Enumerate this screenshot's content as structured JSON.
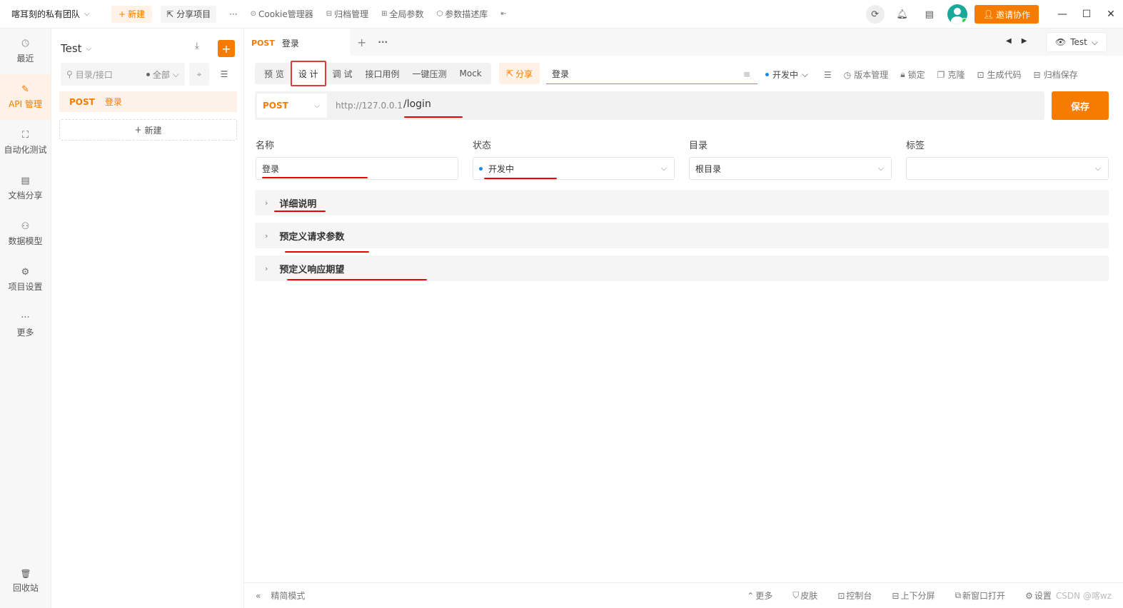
{
  "topbar": {
    "team": "喀耳刻的私有团队",
    "new_label": "新建",
    "share_project": "分享项目",
    "more": "···",
    "links": [
      {
        "icon": "cookie-icon",
        "label": "Cookie管理器"
      },
      {
        "icon": "archive-icon",
        "label": "归档管理"
      },
      {
        "icon": "global-params-icon",
        "label": "全局参数"
      },
      {
        "icon": "param-desc-icon",
        "label": "参数描述库"
      }
    ],
    "invite_label": "邀请协作"
  },
  "leftnav": {
    "items": [
      {
        "icon": "clock-icon",
        "label": "最近",
        "active": false
      },
      {
        "icon": "api-edit-icon",
        "label": "API 管理",
        "active": true
      },
      {
        "icon": "automation-icon",
        "label": "自动化测试",
        "active": false
      },
      {
        "icon": "doc-share-icon",
        "label": "文档分享",
        "active": false
      },
      {
        "icon": "data-model-icon",
        "label": "数据模型",
        "active": false
      },
      {
        "icon": "project-settings-icon",
        "label": "项目设置",
        "active": false
      },
      {
        "icon": "more-dots-icon",
        "label": "更多",
        "active": false
      }
    ],
    "trash_label": "回收站"
  },
  "tree": {
    "project": "Test",
    "search_placeholder": "目录/接口",
    "filter_label": "全部",
    "item_method": "POST",
    "item_name": "登录",
    "new_label": "新建"
  },
  "tabs": {
    "active_method": "POST",
    "active_name": "登录",
    "env": "Test"
  },
  "subtabs": [
    "预 览",
    "设 计",
    "调 试",
    "接口用例",
    "一键压测",
    "Mock"
  ],
  "active_subtab": 1,
  "share_label": "分享",
  "api_name": "登录",
  "status_small": "开发中",
  "tools": [
    "版本管理",
    "锁定",
    "克隆",
    "生成代码",
    "归档保存"
  ],
  "url": {
    "method": "POST",
    "base": "http://127.0.0.1",
    "path": "/login"
  },
  "save_label": "保存",
  "form": {
    "name_label": "名称",
    "name_value": "登录",
    "status_label": "状态",
    "status_value": "开发中",
    "dir_label": "目录",
    "dir_value": "根目录",
    "tag_label": "标签",
    "tag_value": ""
  },
  "sections": [
    "详细说明",
    "预定义请求参数",
    "预定义响应期望"
  ],
  "bottom": {
    "simple_mode": "精简模式",
    "items": [
      "更多",
      "皮肤",
      "控制台",
      "上下分屏",
      "新窗口打开",
      "设置"
    ],
    "watermark": "CSDN @喀wz"
  },
  "colors": {
    "accent": "#f57c00",
    "annotation": "#e00000",
    "status_dot": "#1e88e5"
  }
}
